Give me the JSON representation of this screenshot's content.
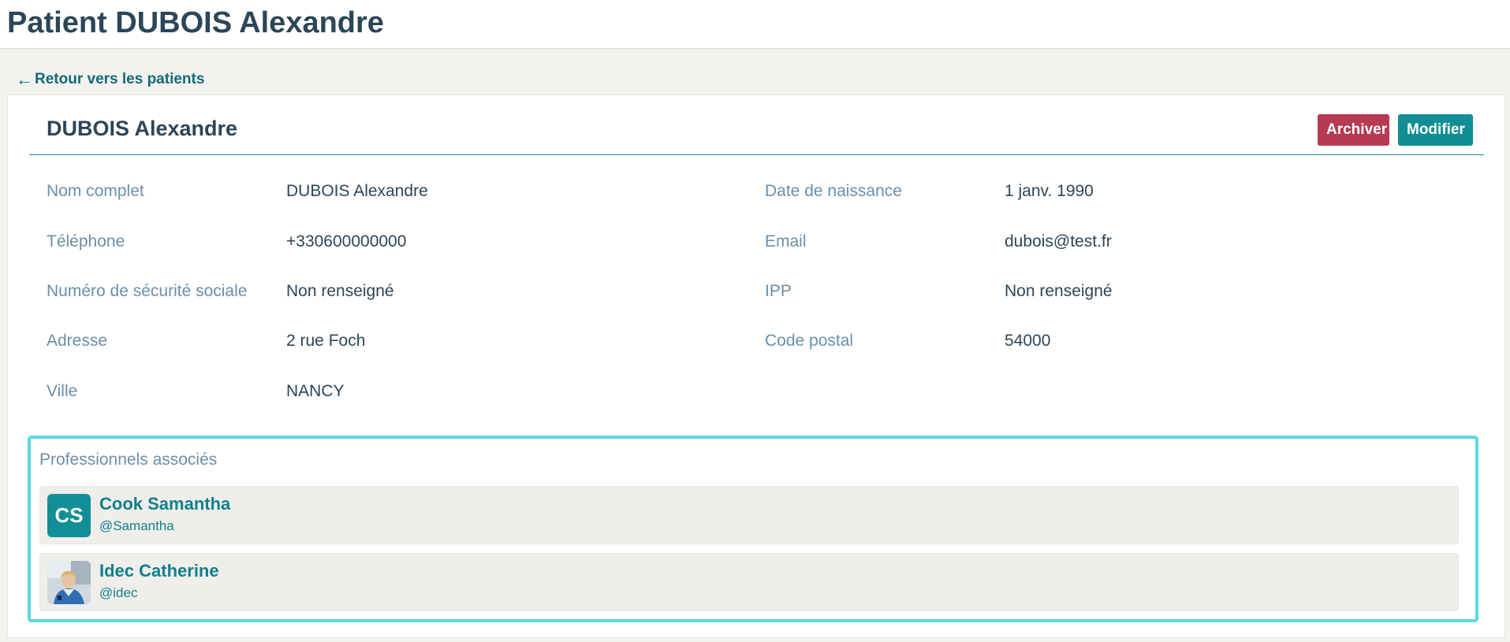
{
  "header": {
    "title": "Patient DUBOIS Alexandre"
  },
  "nav": {
    "back_label": "Retour vers les patients"
  },
  "card": {
    "title": "DUBOIS Alexandre",
    "archive_label": "Archiver",
    "edit_label": "Modifier"
  },
  "info": {
    "full_name": {
      "label": "Nom complet",
      "value": "DUBOIS Alexandre"
    },
    "birth_date": {
      "label": "Date de naissance",
      "value": "1 janv. 1990"
    },
    "phone": {
      "label": "Téléphone",
      "value": "+330600000000"
    },
    "email": {
      "label": "Email",
      "value": "dubois@test.fr"
    },
    "ssn": {
      "label": "Numéro de sécurité sociale",
      "value": "Non renseigné"
    },
    "ipp": {
      "label": "IPP",
      "value": "Non renseigné"
    },
    "address": {
      "label": "Adresse",
      "value": "2 rue Foch"
    },
    "postal_code": {
      "label": "Code postal",
      "value": "54000"
    },
    "city": {
      "label": "Ville",
      "value": "NANCY"
    }
  },
  "professionals": {
    "title": "Professionnels associés",
    "items": [
      {
        "initials": "CS",
        "name": "Cook Samantha",
        "handle": "@Samantha"
      },
      {
        "initials": "",
        "name": "Idec Catherine",
        "handle": "@idec"
      }
    ]
  },
  "colors": {
    "primary": "#108e94",
    "danger": "#b53a52",
    "highlight_border": "#5ad8df",
    "label": "#6b8fa9",
    "text": "#2c4658"
  },
  "icons": {
    "back": "arrow-left-icon"
  }
}
